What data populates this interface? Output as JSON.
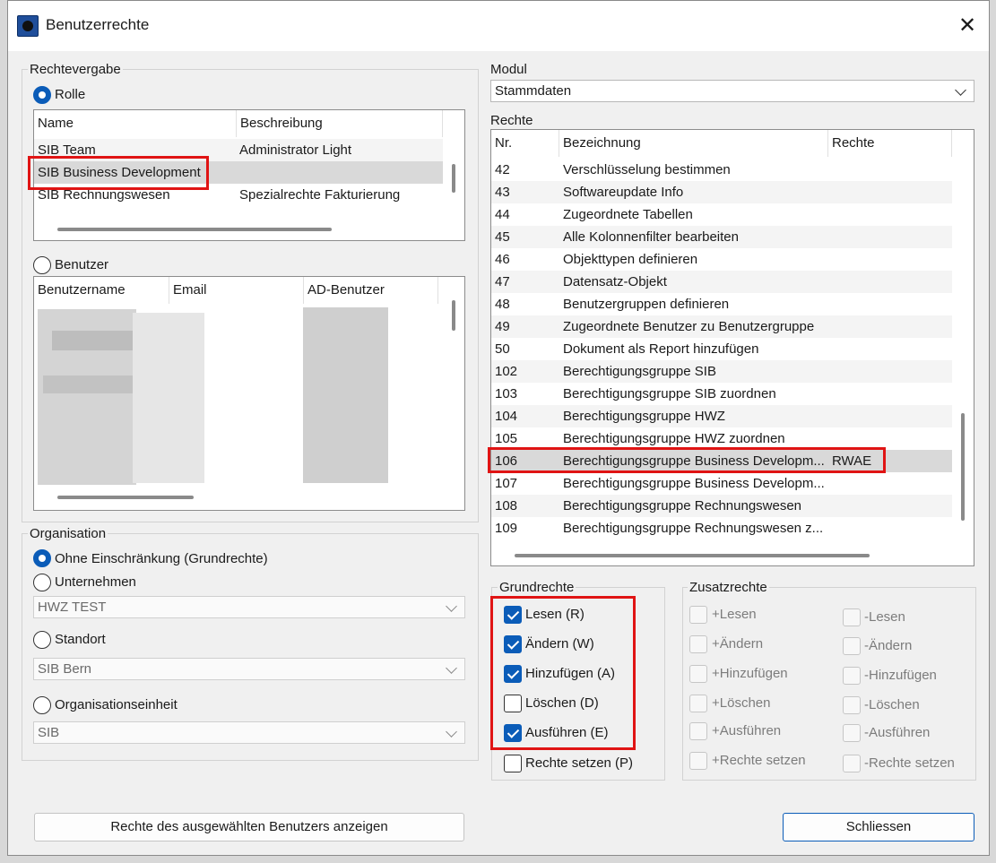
{
  "window": {
    "title": "Benutzerrechte"
  },
  "rechtevergabe": {
    "label": "Rechtevergabe",
    "rolle_label": "Rolle",
    "rolle_columns": [
      "Name",
      "Beschreibung"
    ],
    "rolle_rows": [
      {
        "name": "SIB Team",
        "beschreibung": "Administrator Light"
      },
      {
        "name": "SIB Business Development",
        "beschreibung": ""
      },
      {
        "name": "SIB Rechnungswesen",
        "beschreibung": "Spezialrechte Fakturierung"
      }
    ],
    "benutzer_label": "Benutzer",
    "benutzer_columns": [
      "Benutzername",
      "Email",
      "AD-Benutzer"
    ]
  },
  "organisation": {
    "label": "Organisation",
    "ohne_label": "Ohne Einschränkung (Grundrechte)",
    "unternehmen_label": "Unternehmen",
    "unternehmen_value": "HWZ TEST",
    "standort_label": "Standort",
    "standort_value": "SIB Bern",
    "orgeinheit_label": "Organisationseinheit",
    "orgeinheit_value": "SIB"
  },
  "modul": {
    "label": "Modul",
    "value": "Stammdaten"
  },
  "rechte": {
    "label": "Rechte",
    "columns": [
      "Nr.",
      "Bezeichnung",
      "Rechte"
    ],
    "rows": [
      {
        "nr": "42",
        "bez": "Verschlüsselung bestimmen",
        "rechte": ""
      },
      {
        "nr": "43",
        "bez": "Softwareupdate Info",
        "rechte": ""
      },
      {
        "nr": "44",
        "bez": "Zugeordnete Tabellen",
        "rechte": ""
      },
      {
        "nr": "45",
        "bez": "Alle Kolonnenfilter bearbeiten",
        "rechte": ""
      },
      {
        "nr": "46",
        "bez": "Objekttypen definieren",
        "rechte": ""
      },
      {
        "nr": "47",
        "bez": "Datensatz-Objekt",
        "rechte": ""
      },
      {
        "nr": "48",
        "bez": "Benutzergruppen definieren",
        "rechte": ""
      },
      {
        "nr": "49",
        "bez": "Zugeordnete Benutzer zu Benutzergruppe",
        "rechte": ""
      },
      {
        "nr": "50",
        "bez": "Dokument als Report hinzufügen",
        "rechte": ""
      },
      {
        "nr": "102",
        "bez": "Berechtigungsgruppe SIB",
        "rechte": ""
      },
      {
        "nr": "103",
        "bez": "Berechtigungsgruppe SIB zuordnen",
        "rechte": ""
      },
      {
        "nr": "104",
        "bez": "Berechtigungsgruppe HWZ",
        "rechte": ""
      },
      {
        "nr": "105",
        "bez": "Berechtigungsgruppe HWZ zuordnen",
        "rechte": ""
      },
      {
        "nr": "106",
        "bez": "Berechtigungsgruppe Business Developm...",
        "rechte": "RWAE"
      },
      {
        "nr": "107",
        "bez": "Berechtigungsgruppe Business Developm...",
        "rechte": ""
      },
      {
        "nr": "108",
        "bez": "Berechtigungsgruppe Rechnungswesen",
        "rechte": ""
      },
      {
        "nr": "109",
        "bez": "Berechtigungsgruppe Rechnungswesen z...",
        "rechte": ""
      }
    ]
  },
  "grundrechte": {
    "label": "Grundrechte",
    "items": [
      {
        "label": "Lesen (R)",
        "checked": true
      },
      {
        "label": "Ändern (W)",
        "checked": true
      },
      {
        "label": "Hinzufügen (A)",
        "checked": true
      },
      {
        "label": "Löschen (D)",
        "checked": false
      },
      {
        "label": "Ausführen (E)",
        "checked": true
      },
      {
        "label": "Rechte setzen (P)",
        "checked": false
      }
    ]
  },
  "zusatzrechte": {
    "label": "Zusatzrechte",
    "plus": [
      "+Lesen",
      "+Ändern",
      "+Hinzufügen",
      "+Löschen",
      "+Ausführen",
      "+Rechte setzen"
    ],
    "minus": [
      "-Lesen",
      "-Ändern",
      "-Hinzufügen",
      "-Löschen",
      "-Ausführen",
      "-Rechte setzen"
    ]
  },
  "buttons": {
    "show_user_rights": "Rechte des ausgewählten Benutzers anzeigen",
    "close": "Schliessen"
  },
  "colors": {
    "accent": "#0b5cb8",
    "highlight": "#e01414",
    "selected_row": "#d9d9d9"
  }
}
